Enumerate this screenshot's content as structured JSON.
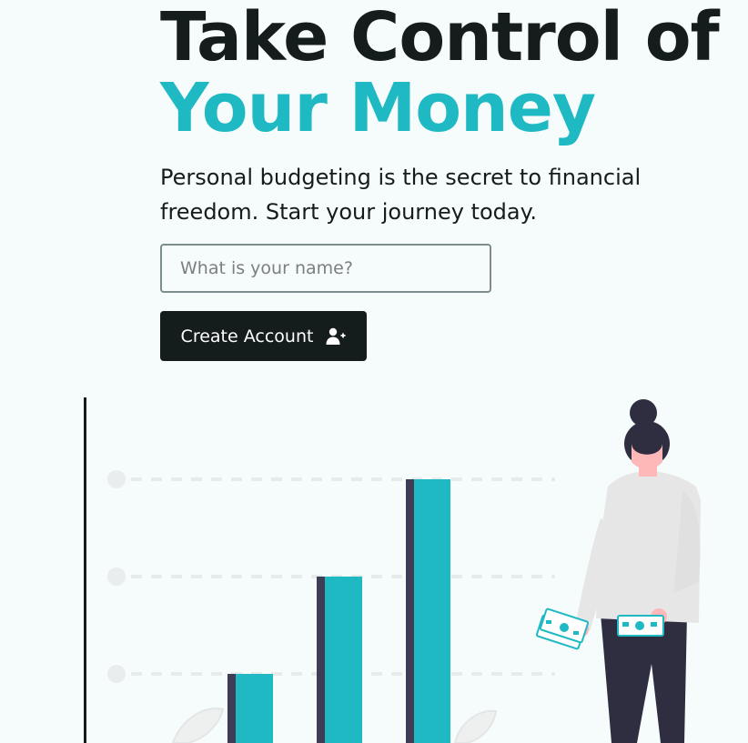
{
  "hero": {
    "title_line1": "Take Control of",
    "title_line2": "Your Money",
    "subtitle": "Personal budgeting is the secret to financial freedom. Start your journey today."
  },
  "form": {
    "name_placeholder": "What is your name?",
    "name_value": "",
    "submit_label": "Create Account",
    "submit_icon": "user-plus-icon"
  },
  "colors": {
    "accent": "#1fb9c3",
    "dark": "#141c1c",
    "background": "#f6fbfb",
    "bar_shadow": "#3f3d56"
  },
  "illustration": {
    "subject": "woman-holding-money-bills",
    "bar_count": 3
  }
}
